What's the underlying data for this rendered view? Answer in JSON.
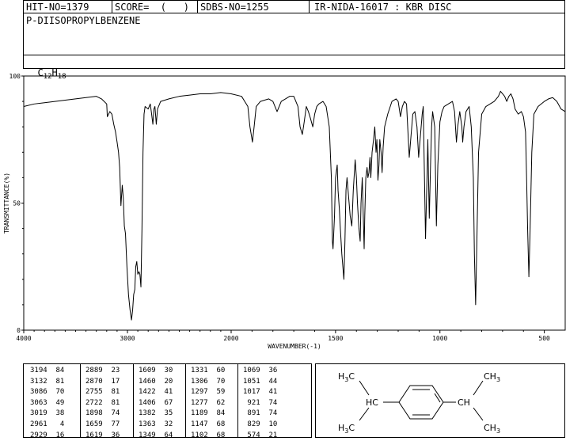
{
  "header": {
    "hit_no": "HIT-NO=1379",
    "score": "SCORE=  (   )",
    "sdbs_no": "SDBS-NO=1255",
    "ir_info": "IR-NIDA-16017 : KBR DISC",
    "compound_name": "P-DIISOPROPYLBENZENE",
    "formula_main": "C",
    "formula_sub1": "12",
    "formula_h": "H",
    "formula_sub2": "18"
  },
  "chart_data": {
    "type": "line",
    "xlabel": "WAVENUMBER(-1)",
    "ylabel": "TRANSMITTANCE(%)",
    "xlim": [
      4000,
      400
    ],
    "ylim": [
      0,
      100
    ],
    "x_ticks": [
      "4000",
      "3000",
      "2000",
      "1500",
      "1000",
      "500"
    ],
    "y_ticks": [
      "100",
      "50",
      "0"
    ],
    "series": [
      {
        "points": [
          [
            4000,
            88
          ],
          [
            3900,
            89
          ],
          [
            3800,
            89.5
          ],
          [
            3700,
            90
          ],
          [
            3600,
            90.5
          ],
          [
            3500,
            91
          ],
          [
            3400,
            91.5
          ],
          [
            3300,
            92
          ],
          [
            3250,
            91
          ],
          [
            3200,
            89
          ],
          [
            3194,
            84
          ],
          [
            3170,
            86
          ],
          [
            3150,
            85
          ],
          [
            3132,
            81
          ],
          [
            3115,
            78
          ],
          [
            3100,
            74
          ],
          [
            3086,
            70
          ],
          [
            3075,
            64
          ],
          [
            3063,
            49
          ],
          [
            3050,
            57
          ],
          [
            3040,
            52
          ],
          [
            3030,
            41
          ],
          [
            3019,
            38
          ],
          [
            3005,
            25
          ],
          [
            2990,
            14
          ],
          [
            2975,
            8
          ],
          [
            2961,
            4
          ],
          [
            2950,
            8
          ],
          [
            2940,
            14
          ],
          [
            2929,
            16
          ],
          [
            2920,
            25
          ],
          [
            2910,
            27
          ],
          [
            2900,
            22
          ],
          [
            2889,
            23
          ],
          [
            2880,
            22
          ],
          [
            2870,
            17
          ],
          [
            2860,
            40
          ],
          [
            2850,
            70
          ],
          [
            2840,
            85
          ],
          [
            2830,
            88
          ],
          [
            2800,
            87
          ],
          [
            2780,
            89
          ],
          [
            2770,
            86
          ],
          [
            2755,
            81
          ],
          [
            2745,
            87
          ],
          [
            2735,
            88
          ],
          [
            2722,
            81
          ],
          [
            2710,
            87
          ],
          [
            2680,
            90
          ],
          [
            2600,
            91
          ],
          [
            2500,
            92
          ],
          [
            2400,
            92.5
          ],
          [
            2300,
            93
          ],
          [
            2200,
            93
          ],
          [
            2100,
            93.5
          ],
          [
            2000,
            93
          ],
          [
            1950,
            92
          ],
          [
            1920,
            88
          ],
          [
            1910,
            80
          ],
          [
            1898,
            74
          ],
          [
            1890,
            80
          ],
          [
            1880,
            88
          ],
          [
            1860,
            90
          ],
          [
            1820,
            91
          ],
          [
            1800,
            90
          ],
          [
            1790,
            88
          ],
          [
            1780,
            86
          ],
          [
            1770,
            88
          ],
          [
            1760,
            90
          ],
          [
            1740,
            91
          ],
          [
            1720,
            92
          ],
          [
            1700,
            92
          ],
          [
            1680,
            88
          ],
          [
            1670,
            80
          ],
          [
            1659,
            77
          ],
          [
            1650,
            82
          ],
          [
            1640,
            88
          ],
          [
            1630,
            86
          ],
          [
            1619,
            83
          ],
          [
            1609,
            80
          ],
          [
            1600,
            85
          ],
          [
            1590,
            88
          ],
          [
            1580,
            89
          ],
          [
            1560,
            90
          ],
          [
            1545,
            88
          ],
          [
            1530,
            80
          ],
          [
            1520,
            60
          ],
          [
            1515,
            35
          ],
          [
            1512,
            32
          ],
          [
            1505,
            45
          ],
          [
            1500,
            60
          ],
          [
            1492,
            65
          ],
          [
            1488,
            55
          ],
          [
            1482,
            48
          ],
          [
            1477,
            40
          ],
          [
            1470,
            30
          ],
          [
            1460,
            20
          ],
          [
            1455,
            35
          ],
          [
            1450,
            55
          ],
          [
            1445,
            60
          ],
          [
            1440,
            55
          ],
          [
            1435,
            50
          ],
          [
            1430,
            45
          ],
          [
            1422,
            41
          ],
          [
            1415,
            55
          ],
          [
            1406,
            67
          ],
          [
            1400,
            60
          ],
          [
            1395,
            50
          ],
          [
            1388,
            40
          ],
          [
            1382,
            35
          ],
          [
            1378,
            50
          ],
          [
            1372,
            60
          ],
          [
            1363,
            32
          ],
          [
            1360,
            45
          ],
          [
            1355,
            60
          ],
          [
            1349,
            64
          ],
          [
            1345,
            60
          ],
          [
            1340,
            62
          ],
          [
            1335,
            68
          ],
          [
            1331,
            60
          ],
          [
            1325,
            70
          ],
          [
            1318,
            75
          ],
          [
            1312,
            80
          ],
          [
            1306,
            70
          ],
          [
            1302,
            75
          ],
          [
            1297,
            59
          ],
          [
            1292,
            65
          ],
          [
            1288,
            75
          ],
          [
            1282,
            70
          ],
          [
            1277,
            62
          ],
          [
            1272,
            72
          ],
          [
            1265,
            80
          ],
          [
            1250,
            85
          ],
          [
            1230,
            90
          ],
          [
            1210,
            91
          ],
          [
            1200,
            90
          ],
          [
            1189,
            84
          ],
          [
            1180,
            88
          ],
          [
            1170,
            90
          ],
          [
            1160,
            89
          ],
          [
            1147,
            68
          ],
          [
            1140,
            75
          ],
          [
            1130,
            85
          ],
          [
            1120,
            86
          ],
          [
            1110,
            80
          ],
          [
            1102,
            68
          ],
          [
            1095,
            75
          ],
          [
            1085,
            85
          ],
          [
            1080,
            88
          ],
          [
            1069,
            36
          ],
          [
            1062,
            60
          ],
          [
            1058,
            75
          ],
          [
            1051,
            44
          ],
          [
            1045,
            65
          ],
          [
            1040,
            80
          ],
          [
            1035,
            86
          ],
          [
            1025,
            80
          ],
          [
            1017,
            41
          ],
          [
            1010,
            65
          ],
          [
            1000,
            82
          ],
          [
            990,
            86
          ],
          [
            980,
            88
          ],
          [
            960,
            89
          ],
          [
            940,
            90
          ],
          [
            930,
            86
          ],
          [
            921,
            74
          ],
          [
            915,
            80
          ],
          [
            905,
            86
          ],
          [
            895,
            80
          ],
          [
            891,
            74
          ],
          [
            885,
            80
          ],
          [
            875,
            86
          ],
          [
            860,
            88
          ],
          [
            850,
            80
          ],
          [
            840,
            60
          ],
          [
            835,
            30
          ],
          [
            829,
            10
          ],
          [
            822,
            40
          ],
          [
            815,
            70
          ],
          [
            800,
            85
          ],
          [
            780,
            88
          ],
          [
            760,
            89
          ],
          [
            740,
            90
          ],
          [
            720,
            92
          ],
          [
            710,
            94
          ],
          [
            700,
            93
          ],
          [
            690,
            92
          ],
          [
            680,
            90
          ],
          [
            670,
            92
          ],
          [
            660,
            93
          ],
          [
            650,
            91
          ],
          [
            640,
            87
          ],
          [
            625,
            85
          ],
          [
            610,
            86
          ],
          [
            600,
            84
          ],
          [
            590,
            78
          ],
          [
            585,
            60
          ],
          [
            580,
            40
          ],
          [
            574,
            21
          ],
          [
            568,
            40
          ],
          [
            560,
            70
          ],
          [
            550,
            85
          ],
          [
            530,
            88
          ],
          [
            500,
            90
          ],
          [
            480,
            91
          ],
          [
            460,
            91.5
          ],
          [
            440,
            90
          ],
          [
            420,
            87
          ],
          [
            400,
            86
          ]
        ]
      }
    ]
  },
  "peaks": {
    "col1": [
      "3194  84",
      "3132  81",
      "3086  70",
      "3063  49",
      "3019  38",
      "2961   4",
      "2929  16"
    ],
    "col2": [
      "2889  23",
      "2870  17",
      "2755  81",
      "2722  81",
      "1898  74",
      "1659  77",
      "1619  36"
    ],
    "col3": [
      "1609  30",
      "1460  20",
      "1422  41",
      "1406  67",
      "1382  35",
      "1363  32",
      "1349  64"
    ],
    "col4": [
      "1331  60",
      "1306  70",
      "1297  59",
      "1277  62",
      "1189  84",
      "1147  68",
      "1102  68"
    ],
    "col5": [
      "1069  36",
      "1051  44",
      "1017  41",
      " 921  74",
      " 891  74",
      " 829  10",
      " 574  21"
    ]
  },
  "structure": {
    "h3c_top": "H",
    "h3c_top_sub": "3",
    "h3c_top_c": "C",
    "hc_left": "HC",
    "h3c_bottom": "H",
    "h3c_bottom_sub": "3",
    "h3c_bottom_c": "C",
    "ch3_top_c": "CH",
    "ch3_top_sub": "3",
    "ch_right": "CH",
    "ch3_bottom_c": "CH",
    "ch3_bottom_sub": "3"
  }
}
